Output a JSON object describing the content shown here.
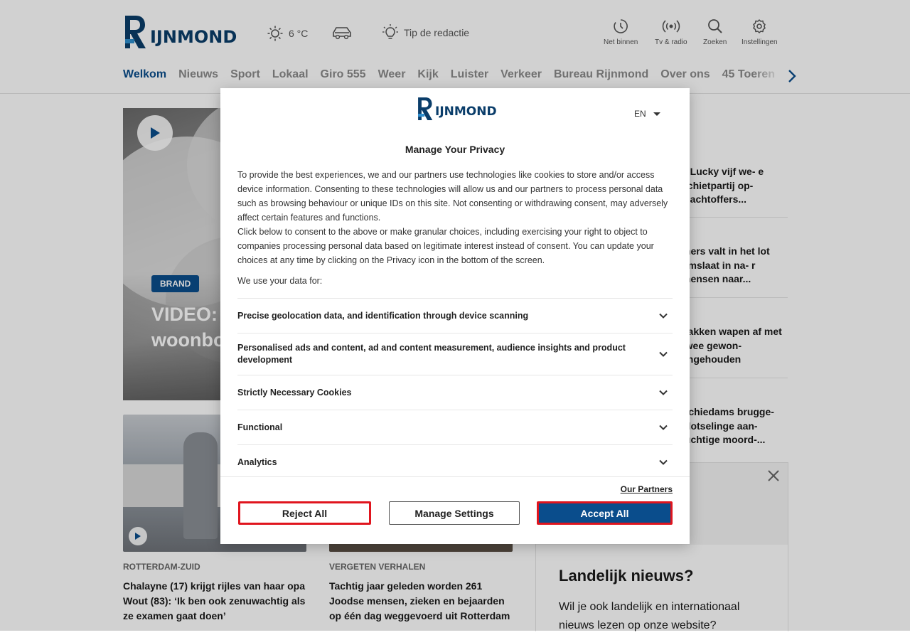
{
  "header": {
    "logo_text": "IJNMOND",
    "weather_temp": "6 °C",
    "tip_label": "Tip de redactie",
    "utilities": [
      {
        "label": "Net binnen"
      },
      {
        "label": "Tv & radio"
      },
      {
        "label": "Zoeken"
      },
      {
        "label": "Instellingen"
      }
    ]
  },
  "nav": {
    "items": [
      "Welkom",
      "Nieuws",
      "Sport",
      "Lokaal",
      "Giro 555",
      "Weer",
      "Kijk",
      "Luister",
      "Verkeer",
      "Bureau Rijnmond",
      "Over ons",
      "45 Toeren"
    ]
  },
  "hero": {
    "tag": "BRAND",
    "title": "VIDEO: T… de as ge… woonbo…"
  },
  "cards": [
    {
      "label": "ROTTERDAM-ZUID",
      "title": "Chalayne (17) krijgt rijles van haar opa Wout (83): ‘Ik ben ook zenuwachtig als ze examen gaat doen’"
    },
    {
      "label": "VERGETEN VERHALEN",
      "title": "Tachtig jaar geleden worden 261 Joodse mensen, zieken en bejaarden op één dag weggevoerd uit Rotterdam"
    }
  ],
  "side_news": [
    "e Lucky vijf we- e schietpartij op- slachtoffers...",
    "mers valt in het lot omslaat in na- r mensen naar...",
    "pakken wapen af met twee gewon- angehouden",
    "Schiedams brugge- plotselinge aan- luchtige moord-..."
  ],
  "promo": {
    "title": "Landelijk nieuws?",
    "text": "Wil je ook landelijk en internationaal nieuws lezen op onze website?"
  },
  "modal": {
    "logo_text": "IJNMOND",
    "language": "EN",
    "title": "Manage Your Privacy",
    "paragraph1": "To provide the best experiences, we and our partners use technologies like cookies to store and/or access device information. Consenting to these technologies will allow us and our partners to process personal data such as browsing behaviour or unique IDs on this site. Not consenting or withdrawing consent, may adversely affect certain features and functions.",
    "paragraph2": "Click below to consent to the above or make granular choices, including exercising your right to object to companies processing personal data based on legitimate interest instead of consent. You can update your choices at any time by clicking on the Privacy icon in the bottom of the screen.",
    "use_label": "We use your data for:",
    "purposes": [
      "Precise geolocation data, and identification through device scanning",
      "Personalised ads and content, ad and content measurement, audience insights and product development",
      "Strictly Necessary Cookies",
      "Functional",
      "Analytics"
    ],
    "partners_link": "Our Partners",
    "reject_label": "Reject All",
    "manage_label": "Manage Settings",
    "accept_label": "Accept All"
  },
  "colors": {
    "brand": "#0a4d8c",
    "highlight_border": "#e0151e"
  }
}
